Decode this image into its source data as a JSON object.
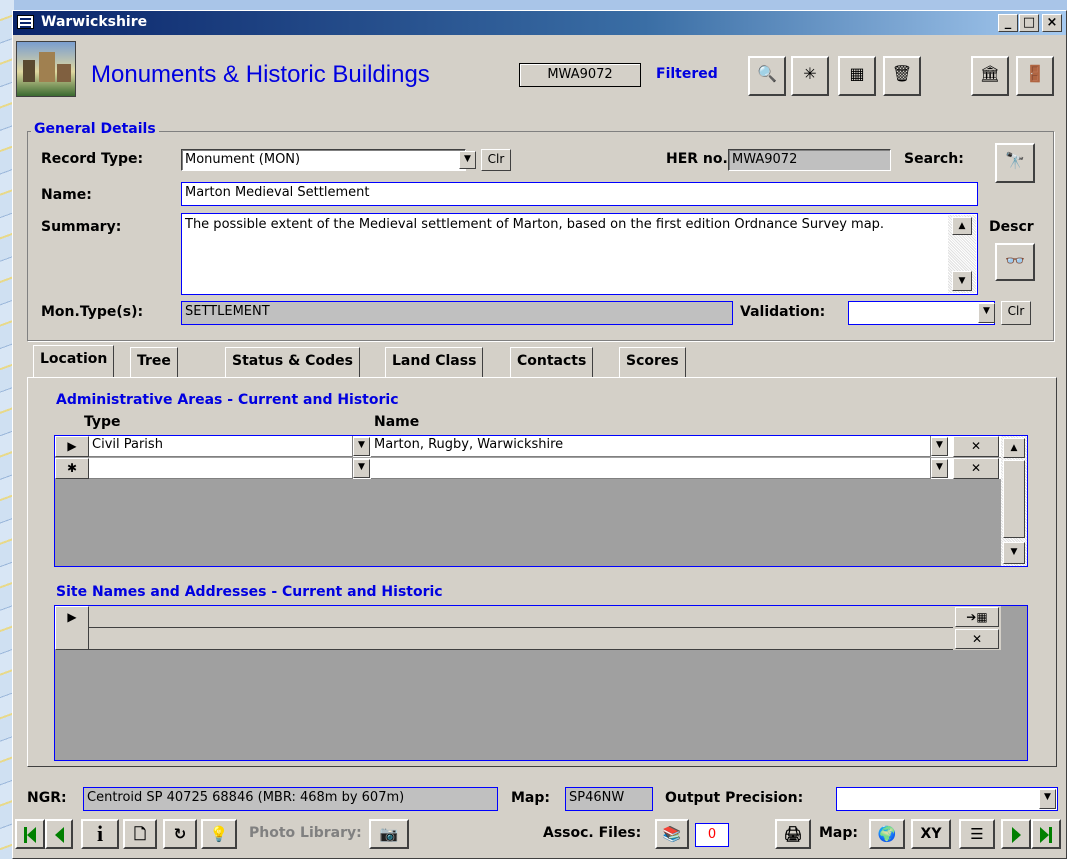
{
  "window": {
    "title": "Warwickshire",
    "caption_min": "_",
    "caption_max": "□",
    "caption_close": "×"
  },
  "header": {
    "title": "Monuments & Historic Buildings",
    "record_id": "MWA9072",
    "filter_status": "Filtered",
    "toolbar_icons": [
      "preview-icon",
      "new-record-icon",
      "add-record-icon",
      "trash-icon",
      "building-icon",
      "exit-icon"
    ]
  },
  "general": {
    "section_title": "General Details",
    "record_type_label": "Record Type:",
    "record_type_value": "Monument (MON)",
    "clr_label": "Clr",
    "her_label": "HER no.",
    "her_value": "MWA9072",
    "search_label": "Search:",
    "name_label": "Name:",
    "name_value": "Marton Medieval Settlement",
    "summary_label": "Summary:",
    "summary_value": "The possible extent of the Medieval settlement of Marton, based on the first edition Ordnance Survey map.",
    "descr_label": "Descr",
    "montype_label": "Mon.Type(s):",
    "montype_value": "SETTLEMENT",
    "validation_label": "Validation:",
    "validation_value": "",
    "validation_clr": "Clr"
  },
  "tabs": [
    {
      "label": "Location"
    },
    {
      "label": "Tree"
    },
    {
      "label": "Status & Codes"
    },
    {
      "label": "Land Class"
    },
    {
      "label": "Contacts"
    },
    {
      "label": "Scores"
    }
  ],
  "admin_areas": {
    "title": "Administrative Areas - Current and Historic",
    "col_type": "Type",
    "col_name": "Name",
    "rows": [
      {
        "selector": "▶",
        "type": "Civil Parish",
        "name": "Marton, Rugby, Warwickshire"
      },
      {
        "selector": "✱",
        "type": "",
        "name": ""
      }
    ]
  },
  "site_names": {
    "title": "Site Names and Addresses - Current and Historic",
    "rows": [
      {
        "selector": "▶",
        "value": ""
      }
    ]
  },
  "footer": {
    "ngr_label": "NGR:",
    "ngr_value": "Centroid SP 40725 68846  (MBR: 468m by 607m)",
    "map_label": "Map:",
    "map_value": "SP46NW",
    "precision_label": "Output Precision:",
    "precision_value": ""
  },
  "navbar": {
    "photo_library_label": "Photo Library:",
    "assoc_files_label": "Assoc. Files:",
    "assoc_files_count": "0",
    "map_label": "Map:",
    "xy_label": "XY"
  },
  "colors": {
    "accent_blue": "#0000e0",
    "window_face": "#d4d0c8",
    "title_bar": "#0a246a",
    "count_red": "#ff0000"
  }
}
